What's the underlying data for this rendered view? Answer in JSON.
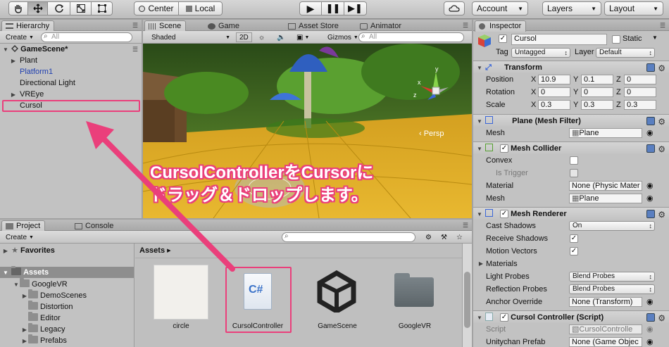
{
  "toolbar": {
    "pivot": "Center",
    "space": "Local",
    "account": "Account",
    "layers": "Layers",
    "layout": "Layout"
  },
  "hierarchy": {
    "tab": "Hierarchy",
    "create": "Create",
    "search_placeholder": "All",
    "scene": "GameScene*",
    "items": [
      {
        "label": "Plant",
        "expandable": true
      },
      {
        "label": "Platform1",
        "expandable": false,
        "prefab": true
      },
      {
        "label": "Directional Light",
        "expandable": false
      },
      {
        "label": "VREye",
        "expandable": true
      },
      {
        "label": "Cursol",
        "expandable": false,
        "selected": true
      }
    ]
  },
  "scene": {
    "tabs": [
      "Scene",
      "Game",
      "Asset Store",
      "Animator"
    ],
    "shading": "Shaded",
    "mode_2d": "2D",
    "gizmos": "Gizmos",
    "search_placeholder": "All",
    "persp": "‹ Persp",
    "gizmo_axes": {
      "x": "x",
      "y": "y",
      "z": "z"
    }
  },
  "annotation": {
    "line1": "CursolControllerをCursorに",
    "line2": "ドラッグ＆ドロップします。"
  },
  "project": {
    "tabs": [
      "Project",
      "Console"
    ],
    "create": "Create",
    "favorites": "Favorites",
    "assets_root": "Assets",
    "tree": [
      "GoogleVR",
      "DemoScenes",
      "Distortion",
      "Editor",
      "Legacy",
      "Prefabs"
    ],
    "breadcrumb": "Assets ▸",
    "assets": [
      {
        "label": "circle",
        "icon": "texture-icon"
      },
      {
        "label": "CursolController",
        "icon": "csharp-script-icon",
        "highlighted": true
      },
      {
        "label": "GameScene",
        "icon": "unity-logo-icon"
      },
      {
        "label": "GoogleVR",
        "icon": "folder-icon"
      }
    ],
    "csharp_glyph": "C#"
  },
  "inspector": {
    "tab": "Inspector",
    "name": "Cursol",
    "static_label": "Static",
    "tag_label": "Tag",
    "tag_value": "Untagged",
    "layer_label": "Layer",
    "layer_value": "Default",
    "transform": {
      "title": "Transform",
      "position_label": "Position",
      "rotation_label": "Rotation",
      "scale_label": "Scale",
      "position": [
        "10.9",
        "0.1",
        "0"
      ],
      "rotation": [
        "0",
        "0",
        "0"
      ],
      "scale": [
        "0.3",
        "0.3",
        "0.3"
      ]
    },
    "mesh_filter": {
      "title": "Plane (Mesh Filter)",
      "mesh_label": "Mesh",
      "mesh_value": "Plane"
    },
    "mesh_collider": {
      "title": "Mesh Collider",
      "convex_label": "Convex",
      "trigger_label": "Is Trigger",
      "material_label": "Material",
      "material_value": "None (Physic Mater",
      "mesh_label": "Mesh",
      "mesh_value": "Plane"
    },
    "mesh_renderer": {
      "title": "Mesh Renderer",
      "cast_label": "Cast Shadows",
      "cast_value": "On",
      "receive_label": "Receive Shadows",
      "motion_label": "Motion Vectors",
      "materials_label": "Materials",
      "light_probes_label": "Light Probes",
      "light_probes_value": "Blend Probes",
      "reflection_label": "Reflection Probes",
      "reflection_value": "Blend Probes",
      "anchor_label": "Anchor Override",
      "anchor_value": "None (Transform)"
    },
    "cursol_controller": {
      "title": "Cursol Controller (Script)",
      "script_label": "Script",
      "script_value": "CursolControlle",
      "prefab_label": "Unitychan Prefab",
      "prefab_value": "None (Game Objec"
    }
  },
  "colors": {
    "accent_pink": "#ea3f7b",
    "selection_blue": "#3d6fd8"
  }
}
